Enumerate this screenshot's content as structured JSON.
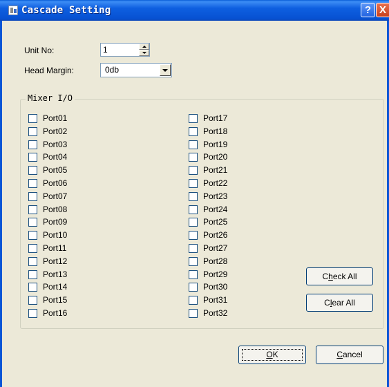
{
  "window": {
    "title": "Cascade Setting",
    "help_label": "?",
    "close_label": "X",
    "accent_color": "#0a56d6",
    "icon": "app-icon"
  },
  "unit_no": {
    "label": "Unit No:",
    "value": "1"
  },
  "head_margin": {
    "label": "Head Margin:",
    "value": "0db"
  },
  "mixer_io": {
    "title": "Mixer I/O",
    "ports_left": [
      "Port01",
      "Port02",
      "Port03",
      "Port04",
      "Port05",
      "Port06",
      "Port07",
      "Port08",
      "Port09",
      "Port10",
      "Port11",
      "Port12",
      "Port13",
      "Port14",
      "Port15",
      "Port16"
    ],
    "ports_right": [
      "Port17",
      "Port18",
      "Port19",
      "Port20",
      "Port21",
      "Port22",
      "Port23",
      "Port24",
      "Port25",
      "Port26",
      "Port27",
      "Port28",
      "Port29",
      "Port30",
      "Port31",
      "Port32"
    ]
  },
  "buttons": {
    "check_all": {
      "pre": "C",
      "key": "h",
      "post": "eck All"
    },
    "clear_all": {
      "pre": "C",
      "key": "l",
      "post": "ear All"
    },
    "ok": {
      "pre": "",
      "key": "O",
      "post": "K"
    },
    "cancel": {
      "pre": "",
      "key": "C",
      "post": "ancel"
    }
  }
}
